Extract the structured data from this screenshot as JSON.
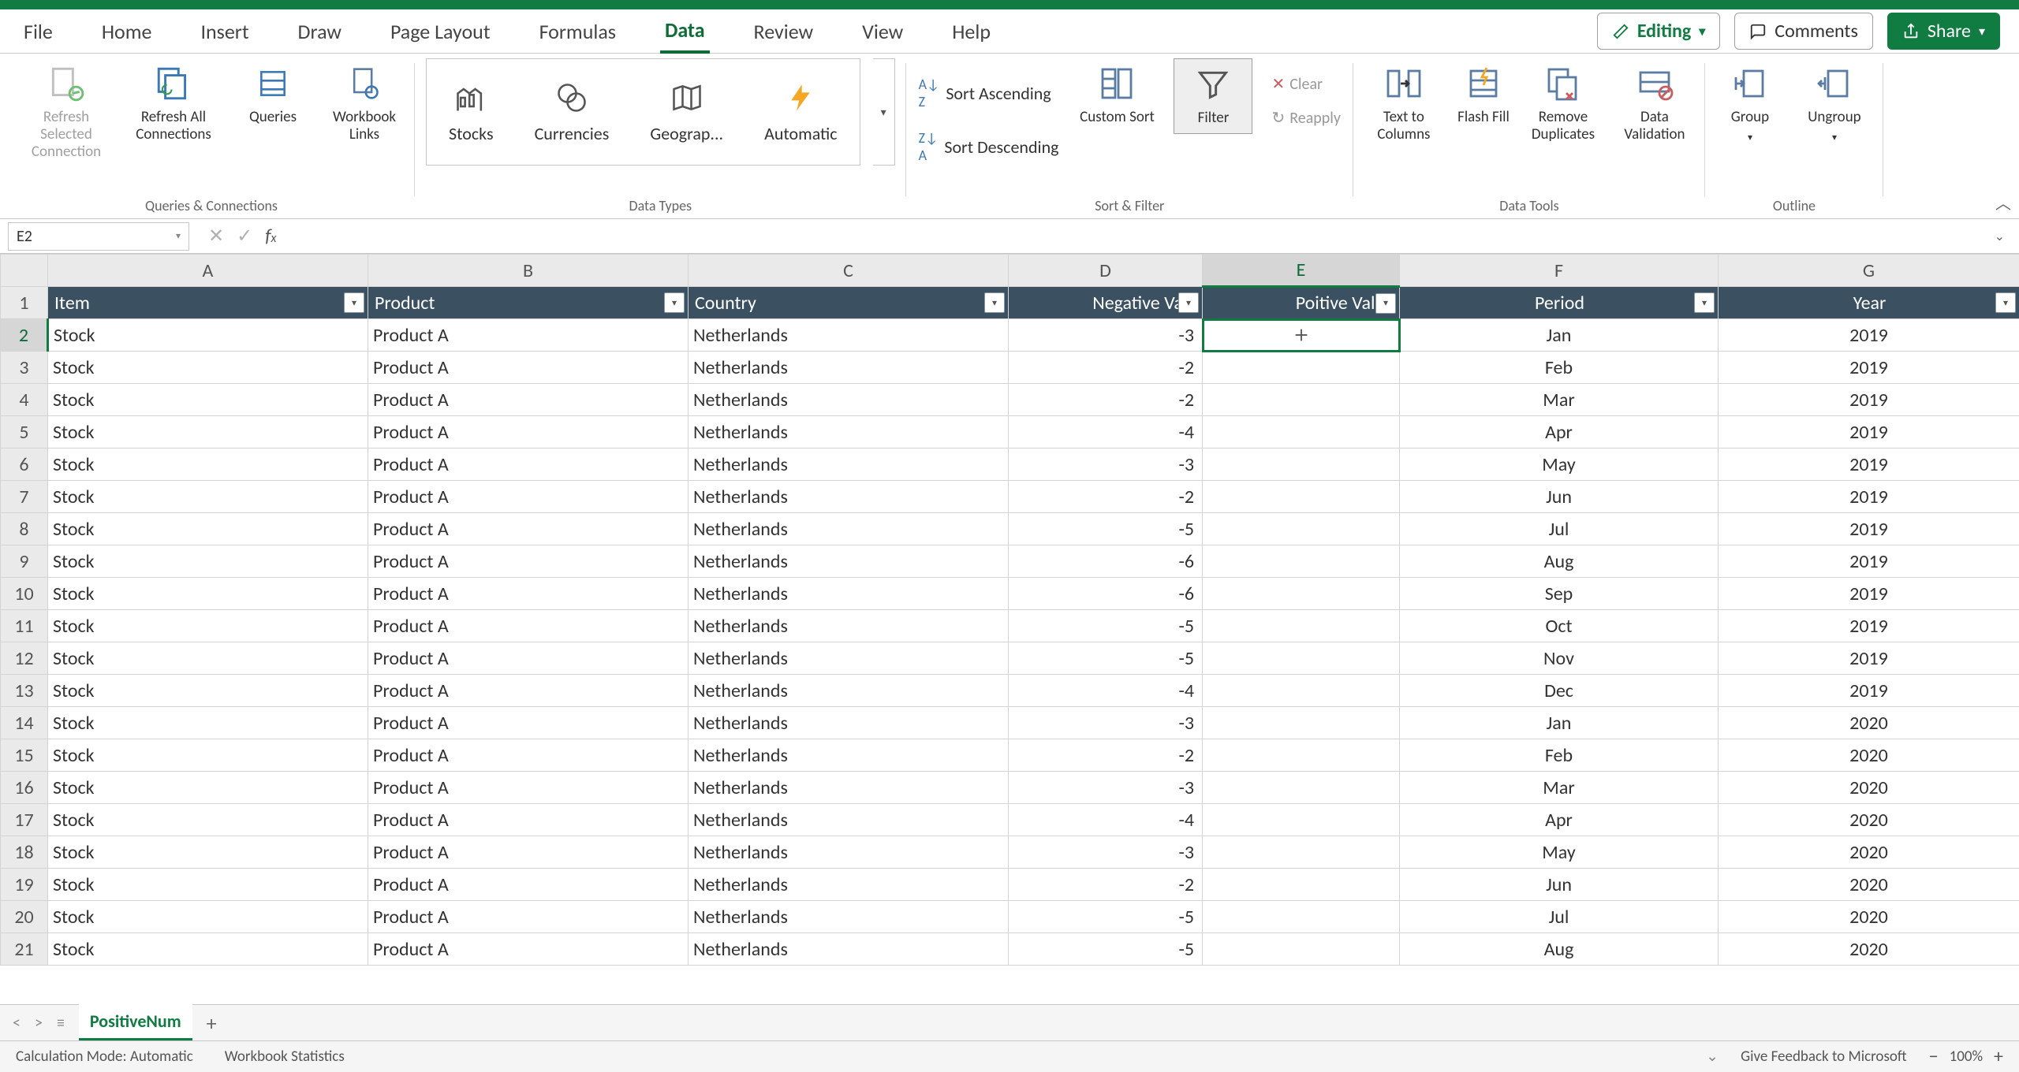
{
  "app": {
    "edit_mode": "Editing",
    "comments": "Comments",
    "share": "Share"
  },
  "tabs": [
    "File",
    "Home",
    "Insert",
    "Draw",
    "Page Layout",
    "Formulas",
    "Data",
    "Review",
    "View",
    "Help"
  ],
  "active_tab": 6,
  "ribbon": {
    "queries_group": "Queries & Connections",
    "refresh_selected": "Refresh Selected Connection",
    "refresh_all": "Refresh All Connections",
    "queries": "Queries",
    "workbook_links": "Workbook Links",
    "datatypes_group": "Data Types",
    "stocks": "Stocks",
    "currencies": "Currencies",
    "geography": "Geograp...",
    "automatic": "Automatic",
    "sortfilter_group": "Sort & Filter",
    "sort_asc": "Sort Ascending",
    "sort_desc": "Sort Descending",
    "custom_sort": "Custom Sort",
    "filter": "Filter",
    "clear": "Clear",
    "reapply": "Reapply",
    "datatools_group": "Data Tools",
    "text_to_cols": "Text to Columns",
    "flash_fill": "Flash Fill",
    "remove_dups": "Remove Duplicates",
    "data_validation": "Data Validation",
    "outline_group": "Outline",
    "group": "Group",
    "ungroup": "Ungroup"
  },
  "namebox": "E2",
  "columns": {
    "A": "A",
    "B": "B",
    "C": "C",
    "D": "D",
    "E": "E",
    "F": "F",
    "G": "G"
  },
  "col_widths": {
    "rh": 60,
    "A": 406,
    "B": 406,
    "C": 406,
    "D": 246,
    "E": 250,
    "F": 404,
    "G": 382
  },
  "headers": [
    "Item",
    "Product",
    "Country",
    "Negative Valu",
    "Poitive Value",
    "Period",
    "Year"
  ],
  "rows": [
    {
      "n": 2,
      "item": "Stock",
      "product": "Product A",
      "country": "Netherlands",
      "neg": "-3",
      "pos": "",
      "period": "Jan",
      "year": "2019"
    },
    {
      "n": 3,
      "item": "Stock",
      "product": "Product A",
      "country": "Netherlands",
      "neg": "-2",
      "pos": "",
      "period": "Feb",
      "year": "2019"
    },
    {
      "n": 4,
      "item": "Stock",
      "product": "Product A",
      "country": "Netherlands",
      "neg": "-2",
      "pos": "",
      "period": "Mar",
      "year": "2019"
    },
    {
      "n": 5,
      "item": "Stock",
      "product": "Product A",
      "country": "Netherlands",
      "neg": "-4",
      "pos": "",
      "period": "Apr",
      "year": "2019"
    },
    {
      "n": 6,
      "item": "Stock",
      "product": "Product A",
      "country": "Netherlands",
      "neg": "-3",
      "pos": "",
      "period": "May",
      "year": "2019"
    },
    {
      "n": 7,
      "item": "Stock",
      "product": "Product A",
      "country": "Netherlands",
      "neg": "-2",
      "pos": "",
      "period": "Jun",
      "year": "2019"
    },
    {
      "n": 8,
      "item": "Stock",
      "product": "Product A",
      "country": "Netherlands",
      "neg": "-5",
      "pos": "",
      "period": "Jul",
      "year": "2019"
    },
    {
      "n": 9,
      "item": "Stock",
      "product": "Product A",
      "country": "Netherlands",
      "neg": "-6",
      "pos": "",
      "period": "Aug",
      "year": "2019"
    },
    {
      "n": 10,
      "item": "Stock",
      "product": "Product A",
      "country": "Netherlands",
      "neg": "-6",
      "pos": "",
      "period": "Sep",
      "year": "2019"
    },
    {
      "n": 11,
      "item": "Stock",
      "product": "Product A",
      "country": "Netherlands",
      "neg": "-5",
      "pos": "",
      "period": "Oct",
      "year": "2019"
    },
    {
      "n": 12,
      "item": "Stock",
      "product": "Product A",
      "country": "Netherlands",
      "neg": "-5",
      "pos": "",
      "period": "Nov",
      "year": "2019"
    },
    {
      "n": 13,
      "item": "Stock",
      "product": "Product A",
      "country": "Netherlands",
      "neg": "-4",
      "pos": "",
      "period": "Dec",
      "year": "2019"
    },
    {
      "n": 14,
      "item": "Stock",
      "product": "Product A",
      "country": "Netherlands",
      "neg": "-3",
      "pos": "",
      "period": "Jan",
      "year": "2020"
    },
    {
      "n": 15,
      "item": "Stock",
      "product": "Product A",
      "country": "Netherlands",
      "neg": "-2",
      "pos": "",
      "period": "Feb",
      "year": "2020"
    },
    {
      "n": 16,
      "item": "Stock",
      "product": "Product A",
      "country": "Netherlands",
      "neg": "-3",
      "pos": "",
      "period": "Mar",
      "year": "2020"
    },
    {
      "n": 17,
      "item": "Stock",
      "product": "Product A",
      "country": "Netherlands",
      "neg": "-4",
      "pos": "",
      "period": "Apr",
      "year": "2020"
    },
    {
      "n": 18,
      "item": "Stock",
      "product": "Product A",
      "country": "Netherlands",
      "neg": "-3",
      "pos": "",
      "period": "May",
      "year": "2020"
    },
    {
      "n": 19,
      "item": "Stock",
      "product": "Product A",
      "country": "Netherlands",
      "neg": "-2",
      "pos": "",
      "period": "Jun",
      "year": "2020"
    },
    {
      "n": 20,
      "item": "Stock",
      "product": "Product A",
      "country": "Netherlands",
      "neg": "-5",
      "pos": "",
      "period": "Jul",
      "year": "2020"
    },
    {
      "n": 21,
      "item": "Stock",
      "product": "Product A",
      "country": "Netherlands",
      "neg": "-5",
      "pos": "",
      "period": "Aug",
      "year": "2020"
    }
  ],
  "sheet_tab": "PositiveNum",
  "status": {
    "calc": "Calculation Mode: Automatic",
    "wb": "Workbook Statistics",
    "feedback": "Give Feedback to Microsoft",
    "zoom": "100%"
  }
}
